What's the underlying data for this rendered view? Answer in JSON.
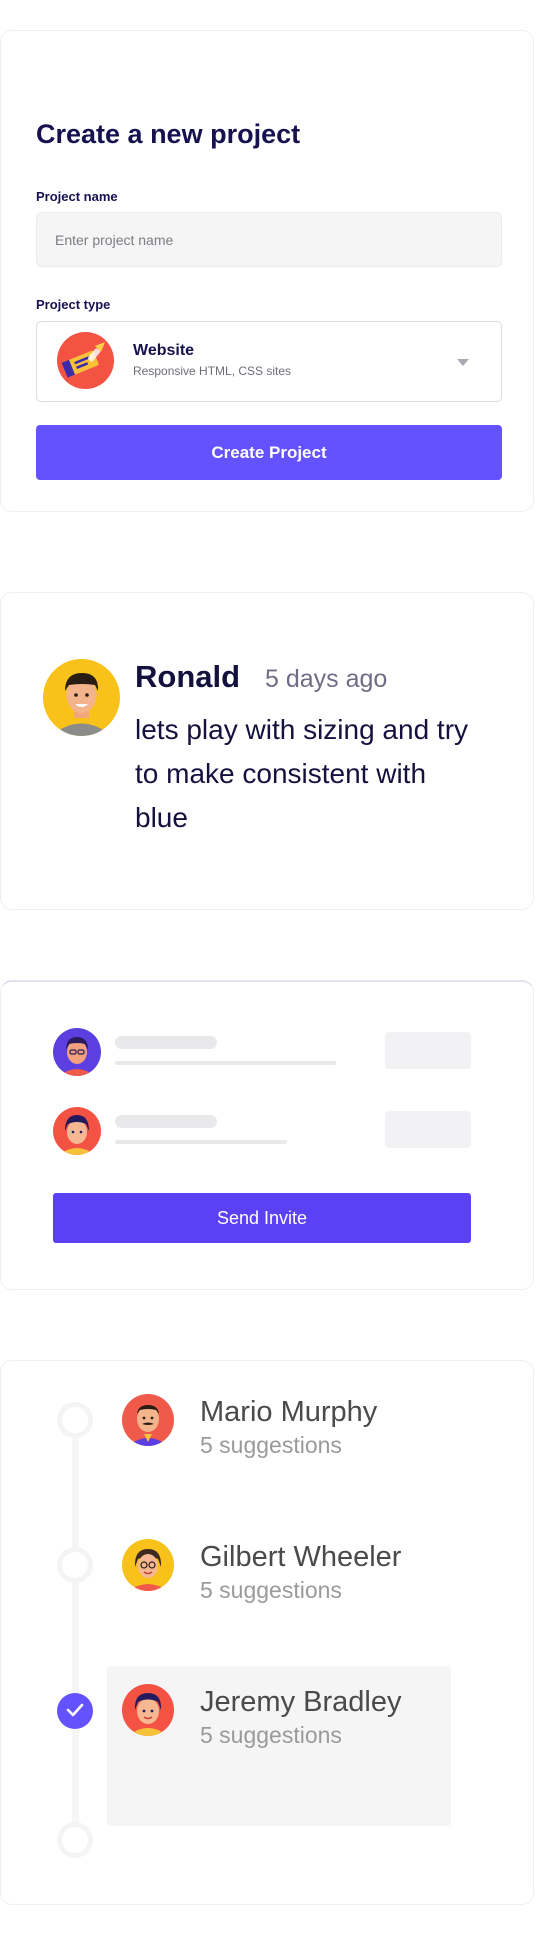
{
  "project_form": {
    "title": "Create a new project",
    "name_label": "Project name",
    "name_placeholder": "Enter project name",
    "name_value": "",
    "type_label": "Project type",
    "selected_type": {
      "title": "Website",
      "subtitle": "Responsive HTML, CSS sites",
      "icon": "website-project-icon"
    },
    "submit_label": "Create Project",
    "accent_color": "#6552ff"
  },
  "comment": {
    "author": "Ronald",
    "time": "5 days ago",
    "message": "lets play with sizing and try to make consistent with blue",
    "avatar": "ronald-avatar"
  },
  "invite": {
    "members": [
      {
        "avatar": "member-avatar-1"
      },
      {
        "avatar": "member-avatar-2"
      }
    ],
    "button_label": "Send Invite",
    "button_color": "#5b40f6"
  },
  "reviewers": [
    {
      "name": "Mario Murphy",
      "suggestions": "5 suggestions",
      "checked": false,
      "highlighted": false
    },
    {
      "name": "Gilbert Wheeler",
      "suggestions": "5 suggestions",
      "checked": false,
      "highlighted": false
    },
    {
      "name": "Jeremy Bradley",
      "suggestions": "5 suggestions",
      "checked": true,
      "highlighted": true
    }
  ]
}
